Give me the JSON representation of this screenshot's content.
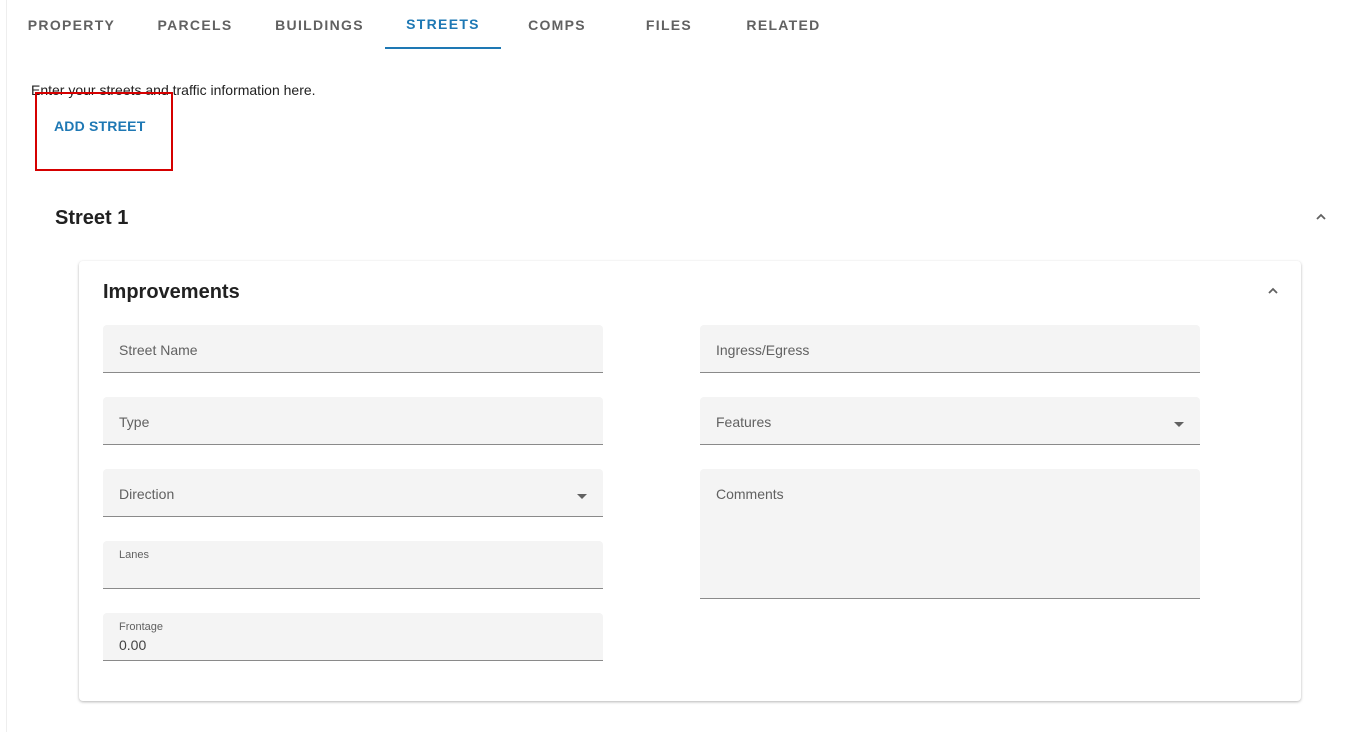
{
  "tabs": [
    {
      "label": "PROPERTY"
    },
    {
      "label": "PARCELS"
    },
    {
      "label": "BUILDINGS"
    },
    {
      "label": "STREETS"
    },
    {
      "label": "COMPS"
    },
    {
      "label": "FILES"
    },
    {
      "label": "RELATED"
    }
  ],
  "active_tab": "STREETS",
  "intro_text": "Enter your streets and traffic information here.",
  "add_street_label": "ADD STREET",
  "street": {
    "title": "Street 1",
    "improvements": {
      "title": "Improvements",
      "fields": {
        "street_name": {
          "label": "Street Name",
          "value": ""
        },
        "type": {
          "label": "Type",
          "value": ""
        },
        "direction": {
          "label": "Direction",
          "value": ""
        },
        "lanes": {
          "label": "Lanes",
          "value": ""
        },
        "frontage": {
          "label": "Frontage",
          "value": "0.00"
        },
        "ingress_egress": {
          "label": "Ingress/Egress",
          "value": ""
        },
        "features": {
          "label": "Features",
          "value": ""
        },
        "comments": {
          "label": "Comments",
          "value": ""
        }
      }
    }
  },
  "colors": {
    "accent": "#1e78b4",
    "highlight": "#d50000",
    "field_bg": "#f4f4f4"
  },
  "icons": {
    "collapse": "chevron-up-icon",
    "dropdown": "caret-down-icon"
  }
}
